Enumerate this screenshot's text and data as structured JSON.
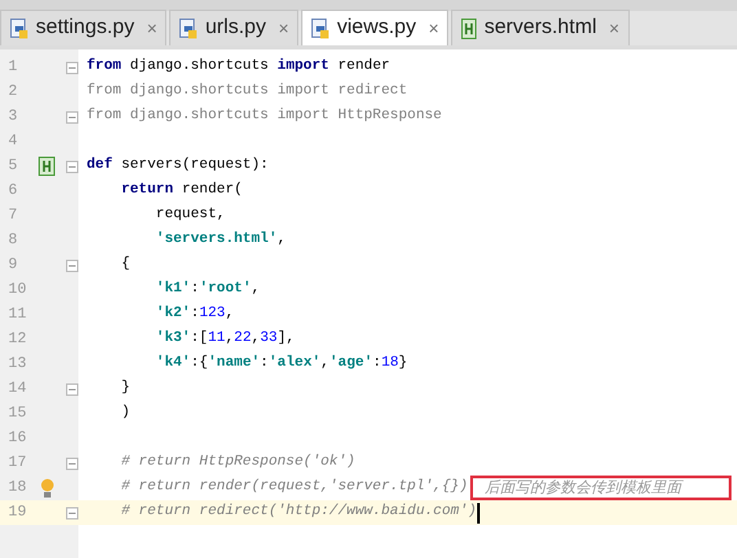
{
  "tabs": [
    {
      "label": "settings.py",
      "kind": "python",
      "selected": false,
      "close": "×"
    },
    {
      "label": "urls.py",
      "kind": "python",
      "selected": false,
      "close": "×"
    },
    {
      "label": "views.py",
      "kind": "python",
      "selected": true,
      "close": "×"
    },
    {
      "label": "servers.html",
      "kind": "html",
      "selected": false,
      "close": "×"
    }
  ],
  "lines": [
    {
      "number": "1",
      "fold": true,
      "tokens": [
        {
          "kind": "kw",
          "text": "from"
        },
        {
          "kind": "plain",
          "text": " django.shortcuts "
        },
        {
          "kind": "kw",
          "text": "import"
        },
        {
          "kind": "plain",
          "text": " render"
        }
      ]
    },
    {
      "number": "2",
      "tokens": [
        {
          "kind": "dim",
          "text": "from django.shortcuts import redirect"
        }
      ]
    },
    {
      "number": "3",
      "fold": true,
      "tokens": [
        {
          "kind": "dim",
          "text": "from django.shortcuts import HttpResponse"
        }
      ]
    },
    {
      "number": "4"
    },
    {
      "number": "5",
      "fold": true,
      "gutter": {
        "kind": "html"
      },
      "tokens": [
        {
          "kind": "kw",
          "text": "def"
        },
        {
          "kind": "plain",
          "text": " servers(request):"
        }
      ]
    },
    {
      "number": "6",
      "tokens": [
        {
          "kind": "kw",
          "text": "    return"
        },
        {
          "kind": "plain",
          "text": " render("
        }
      ]
    },
    {
      "number": "7",
      "tokens": [
        {
          "kind": "plain",
          "text": "        request,"
        }
      ]
    },
    {
      "number": "8",
      "tokens": [
        {
          "kind": "str",
          "text": "        'servers.html'"
        },
        {
          "kind": "plain",
          "text": ","
        }
      ]
    },
    {
      "number": "9",
      "fold": true,
      "tokens": [
        {
          "kind": "plain",
          "text": "    {"
        }
      ]
    },
    {
      "number": "10",
      "tokens": [
        {
          "kind": "str",
          "text": "        'k1'"
        },
        {
          "kind": "plain",
          "text": ":"
        },
        {
          "kind": "str",
          "text": "'root'"
        },
        {
          "kind": "plain",
          "text": ","
        }
      ]
    },
    {
      "number": "11",
      "tokens": [
        {
          "kind": "str",
          "text": "        'k2'"
        },
        {
          "kind": "plain",
          "text": ":"
        },
        {
          "kind": "num",
          "text": "123"
        },
        {
          "kind": "plain",
          "text": ","
        }
      ]
    },
    {
      "number": "12",
      "tokens": [
        {
          "kind": "str",
          "text": "        'k3'"
        },
        {
          "kind": "plain",
          "text": ":["
        },
        {
          "kind": "num",
          "text": "11"
        },
        {
          "kind": "plain",
          "text": ","
        },
        {
          "kind": "num",
          "text": "22"
        },
        {
          "kind": "plain",
          "text": ","
        },
        {
          "kind": "num",
          "text": "33"
        },
        {
          "kind": "plain",
          "text": "],"
        }
      ]
    },
    {
      "number": "13",
      "tokens": [
        {
          "kind": "str",
          "text": "        'k4'"
        },
        {
          "kind": "plain",
          "text": ":{"
        },
        {
          "kind": "str",
          "text": "'name'"
        },
        {
          "kind": "plain",
          "text": ":"
        },
        {
          "kind": "str",
          "text": "'alex'"
        },
        {
          "kind": "plain",
          "text": ","
        },
        {
          "kind": "str",
          "text": "'age'"
        },
        {
          "kind": "plain",
          "text": ":"
        },
        {
          "kind": "num",
          "text": "18"
        },
        {
          "kind": "plain",
          "text": "}"
        }
      ]
    },
    {
      "number": "14",
      "fold": true,
      "tokens": [
        {
          "kind": "plain",
          "text": "    }"
        }
      ]
    },
    {
      "number": "15",
      "tokens": [
        {
          "kind": "plain",
          "text": "    )"
        }
      ]
    },
    {
      "number": "16"
    },
    {
      "number": "17",
      "fold": true,
      "tokens": [
        {
          "kind": "comment",
          "text": "    # return HttpResponse('ok')"
        }
      ]
    },
    {
      "number": "18",
      "gutter": {
        "kind": "bulb"
      },
      "annotation": "后面写的参数会传到模板里面",
      "tokens": [
        {
          "kind": "comment",
          "text": "    # return render(request,'server.tpl',{})"
        }
      ]
    },
    {
      "number": "19",
      "fold": true,
      "current": true,
      "tokens": [
        {
          "kind": "comment",
          "text": "    # return redirect('http://www.baidu.com')"
        }
      ]
    }
  ]
}
